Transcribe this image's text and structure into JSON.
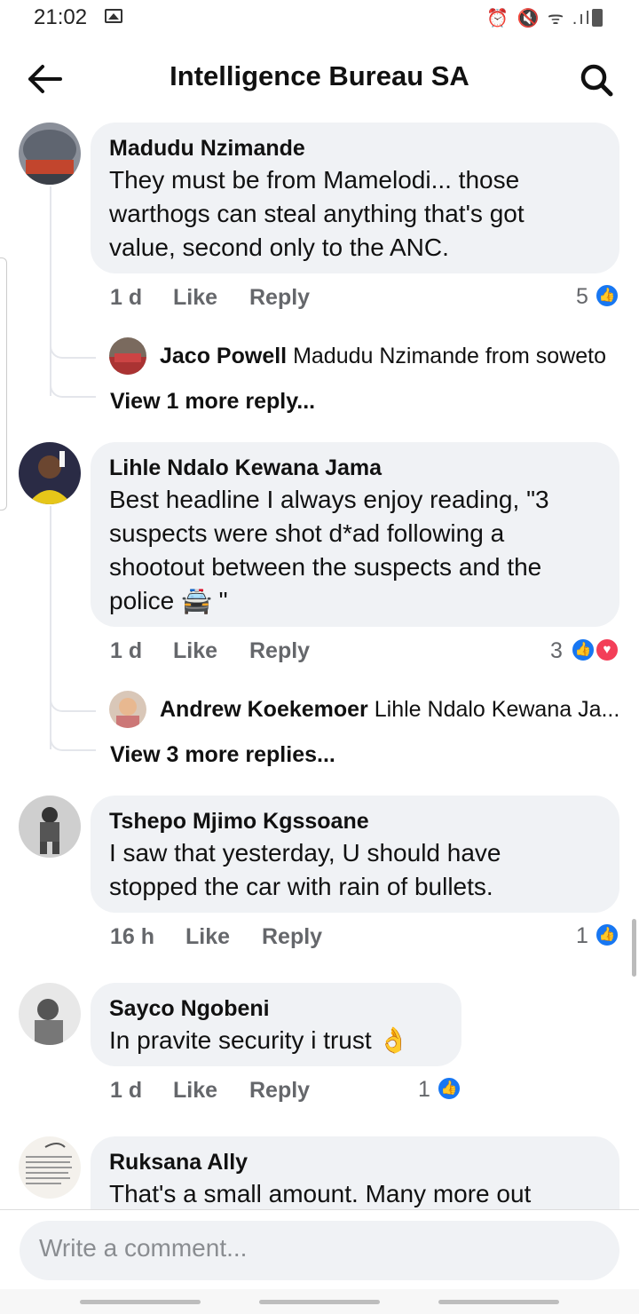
{
  "status_bar": {
    "time": "21:02",
    "icons": "⏰ 🔇 ᯤ .ıl"
  },
  "header": {
    "title": "Intelligence Bureau SA"
  },
  "comments": [
    {
      "author": "Madudu Nzimande",
      "lines": [
        "They must be from Mamelodi... those",
        "warthogs can steal anything that's got",
        "value, second only to the ANC."
      ],
      "time": "1 d",
      "like": "Like",
      "reply": "Reply",
      "reactions": "5",
      "reply_preview": {
        "author": "Jaco Powell",
        "text": "Madudu Nzimande from soweto"
      },
      "more_replies": "View 1 more reply..."
    },
    {
      "author": "Lihle Ndalo Kewana Jama",
      "lines": [
        "Best headline I always enjoy reading, \"3",
        "suspects were shot d*ad following a",
        "shootout between the suspects and the",
        "police 🚔 \""
      ],
      "time": "1 d",
      "like": "Like",
      "reply": "Reply",
      "reactions": "3",
      "reply_preview": {
        "author": "Andrew Koekemoer",
        "text": "Lihle Ndalo Kewana Ja..."
      },
      "more_replies": "View 3 more replies..."
    },
    {
      "author": "Tshepo Mjimo Kgssoane",
      "lines": [
        "I saw that yesterday, U should have",
        "stopped the car with rain of  bullets."
      ],
      "time": "16 h",
      "like": "Like",
      "reply": "Reply",
      "reactions": "1"
    },
    {
      "author": "Sayco Ngobeni",
      "lines": [
        "In pravite security i trust 👌"
      ],
      "time": "1 d",
      "like": "Like",
      "reply": "Reply",
      "reactions": "1"
    },
    {
      "author": "Ruksana Ally",
      "lines": [
        "That's a small amount.  Many more out"
      ]
    }
  ],
  "composer": {
    "placeholder": "Write a comment..."
  },
  "icons": {
    "back": "arrow-left",
    "search": "magnifier",
    "like": "thumbs-up",
    "love": "heart"
  },
  "colors": {
    "like_blue": "#1877f2",
    "love_red": "#f33e58",
    "bubble_bg": "#f0f2f5",
    "meta_gray": "#65676b"
  }
}
